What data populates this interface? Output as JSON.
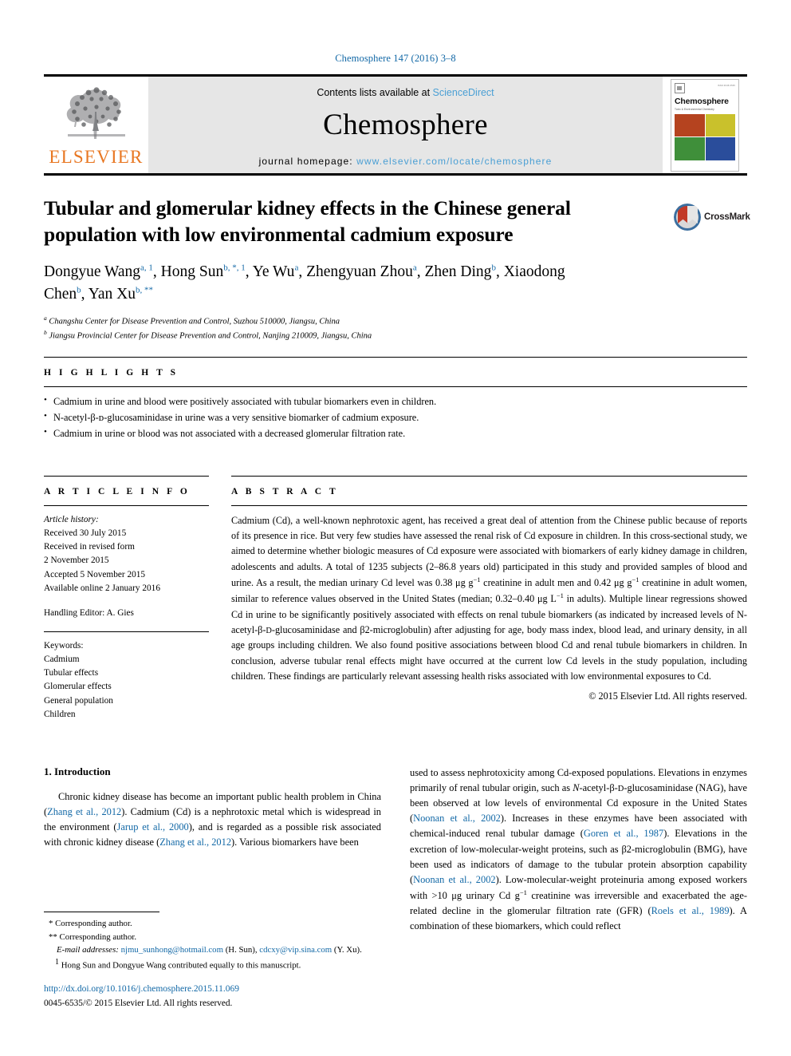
{
  "running_head": "Chemosphere 147 (2016) 3–8",
  "masthead": {
    "publisher_name": "ELSEVIER",
    "contents_prefix": "Contents lists available at ",
    "contents_link": "ScienceDirect",
    "journal_name": "Chemosphere",
    "homepage_prefix": "journal homepage: ",
    "homepage_url": "www.elsevier.com/locate/chemosphere",
    "cover": {
      "title": "Chemosphere",
      "subtitle": "Toxic & Environmental Chemistry",
      "issn": "ISSN 0045-6535",
      "tile_colors": [
        "#b5431f",
        "#c9c12c",
        "#3f8f3a",
        "#2a4d9b"
      ]
    },
    "accent_blue": "#4a9fd4",
    "elsevier_orange": "#e87722"
  },
  "article": {
    "title": "Tubular and glomerular kidney effects in the Chinese general population with low environmental cadmium exposure",
    "authors_line_1_parts": [
      {
        "name": "Dongyue Wang",
        "sup": "a, 1"
      },
      {
        "name": "Hong Sun",
        "sup": "b, *, 1"
      },
      {
        "name": "Ye Wu",
        "sup": "a"
      },
      {
        "name": "Zhengyuan Zhou",
        "sup": "a"
      },
      {
        "name": "Zhen Ding",
        "sup": "b"
      },
      {
        "name": "Xiaodong Chen",
        "sup": "b"
      },
      {
        "name": "Yan Xu",
        "sup": "b, **"
      }
    ],
    "affiliations": [
      {
        "mark": "a",
        "text": "Changshu Center for Disease Prevention and Control, Suzhou 510000, Jiangsu, China"
      },
      {
        "mark": "b",
        "text": "Jiangsu Provincial Center for Disease Prevention and Control, Nanjing 210009, Jiangsu, China"
      }
    ],
    "crossmark_label": "CrossMark"
  },
  "highlights": {
    "heading": "H I G H L I G H T S",
    "items": [
      "Cadmium in urine and blood were positively associated with tubular biomarkers even in children.",
      "N-acetyl-β-ᴅ-glucosaminidase in urine was a very sensitive biomarker of cadmium exposure.",
      "Cadmium in urine or blood was not associated with a decreased glomerular filtration rate."
    ]
  },
  "article_info": {
    "heading": "A R T I C L E  I N F O",
    "history_label": "Article history:",
    "history_lines": [
      "Received 30 July 2015",
      "Received in revised form",
      "2 November 2015",
      "Accepted 5 November 2015",
      "Available online 2 January 2016"
    ],
    "handling_editor": "Handling Editor: A. Gies",
    "keywords_label": "Keywords:",
    "keywords": [
      "Cadmium",
      "Tubular effects",
      "Glomerular effects",
      "General population",
      "Children"
    ]
  },
  "abstract": {
    "heading": "A B S T R A C T",
    "copyright": "© 2015 Elsevier Ltd. All rights reserved.",
    "paragraph_html": "Cadmium (Cd), a well-known nephrotoxic agent, has received a great deal of attention from the Chinese public because of reports of its presence in rice. But very few studies have assessed the renal risk of Cd exposure in children. In this cross-sectional study, we aimed to determine whether biologic measures of Cd exposure were associated with biomarkers of early kidney damage in children, adolescents and adults. A total of 1235 subjects (2&ndash;86.8 years old) participated in this study and provided samples of blood and urine. As a result, the median urinary Cd level was 0.38 &mu;g g<sup class=\"s\">&minus;1</sup> creatinine in adult men and 0.42 &mu;g g<sup class=\"s\">&minus;1</sup> creatinine in adult women, similar to reference values observed in the United States (median; 0.32&ndash;0.40 &mu;g L<sup class=\"s\">&minus;1</sup> in adults). Multiple linear regressions showed Cd in urine to be significantly positively associated with effects on renal tubule biomarkers (as indicated by increased levels of N-acetyl-&beta;-<span style=\"font-size:0.85em\">D</span>-glucosaminidase and &beta;2-microglobulin) after adjusting for age, body mass index, blood lead, and urinary density, in all age groups including children. We also found positive associations between blood Cd and renal tubule biomarkers in children. In conclusion, adverse tubular renal effects might have occurred at the current low Cd levels in the study population, including children. These findings are particularly relevant assessing health risks associated with low environmental exposures to Cd."
  },
  "introduction": {
    "heading": "1. Introduction",
    "left_column_html": "Chronic kidney disease has become an important public health problem in China (<span class=\"ref\">Zhang et al., 2012</span>). Cadmium (Cd) is a nephrotoxic metal which is widespread in the environment (<span class=\"ref\">Jarup et al., 2000</span>), and is regarded as a possible risk associated with chronic kidney disease (<span class=\"ref\">Zhang et al., 2012</span>). Various biomarkers have been",
    "right_column_html": "used to assess nephrotoxicity among Cd-exposed populations. Elevations in enzymes primarily of renal tubular origin, such as <i>N</i>-acetyl-&beta;-<span style=\"font-size:0.85em\">D</span>-glucosaminidase (NAG), have been observed at low levels of environmental Cd exposure in the United States (<span class=\"ref\">Noonan et al., 2002</span>). Increases in these enzymes have been associated with chemical-induced renal tubular damage (<span class=\"ref\">Goren et al., 1987</span>). Elevations in the excretion of low-molecular-weight proteins, such as &beta;2-microglobulin (BMG), have been used as indicators of damage to the tubular protein absorption capability (<span class=\"ref\">Noonan et al., 2002</span>). Low-molecular-weight proteinuria among exposed workers with &gt;10 &mu;g urinary Cd g<sup class=\"s\">&minus;1</sup> creatinine was irreversible and exacerbated the age-related decline in the glomerular filtration rate (GFR) (<span class=\"ref\">Roels et al., 1989</span>). A combination of these biomarkers, which could reflect"
  },
  "footnotes": {
    "corresponding_1": "* Corresponding author.",
    "corresponding_2": "** Corresponding author.",
    "email_label": "E-mail addresses:",
    "email_1": "njmu_sunhong@hotmail.com",
    "email_1_who": "(H. Sun),",
    "email_2": "cdcxy@vip.sina.com",
    "email_2_who": "(Y. Xu).",
    "equal_contrib_mark": "1",
    "equal_contrib": "Hong Sun and Dongyue Wang contributed equally to this manuscript.",
    "doi": "http://dx.doi.org/10.1016/j.chemosphere.2015.11.069",
    "issn_copyright": "0045-6535/© 2015 Elsevier Ltd. All rights reserved."
  }
}
